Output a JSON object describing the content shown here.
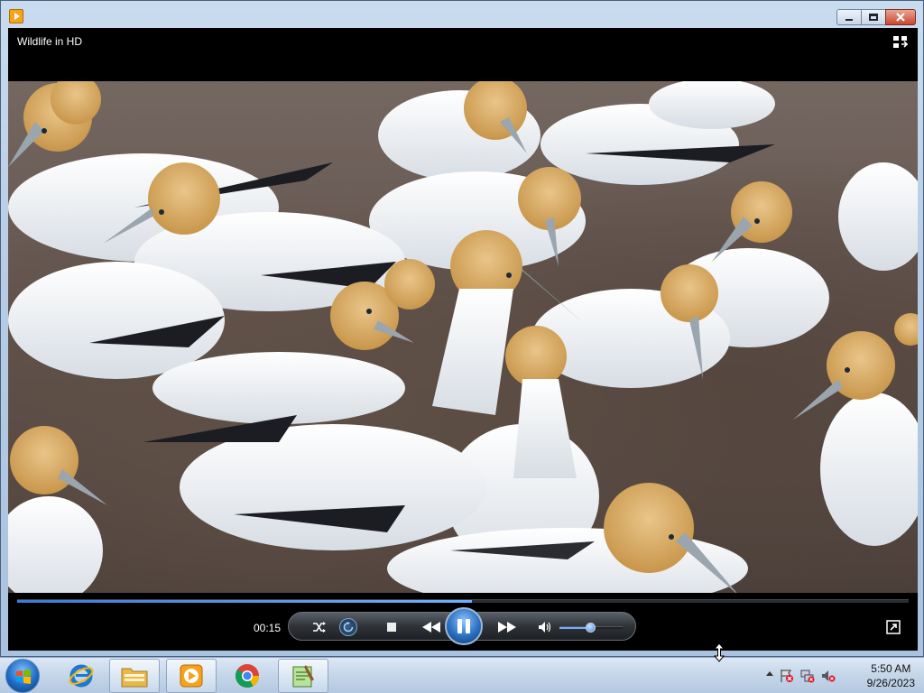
{
  "window": {
    "app_icon": "media-player-icon",
    "caption_buttons": [
      "minimize",
      "maximize",
      "close"
    ]
  },
  "player": {
    "title": "Wildlife in HD",
    "switch_library_icon": "switch-to-library-icon",
    "video_content": "gannet colony",
    "elapsed_time": "00:15",
    "seek_progress": 0.51,
    "volume_level": 0.5,
    "controls": [
      "shuffle",
      "repeat",
      "stop",
      "previous",
      "pause",
      "next",
      "mute",
      "volume",
      "fullscreen"
    ]
  },
  "taskbar": {
    "pinned": [
      {
        "name": "internet-explorer-icon"
      },
      {
        "name": "windows-explorer-icon"
      },
      {
        "name": "windows-media-player-icon"
      },
      {
        "name": "chrome-icon"
      },
      {
        "name": "notepad-plus-plus-icon"
      }
    ],
    "tray": {
      "time": "5:50 AM",
      "date": "9/26/2023"
    }
  }
}
